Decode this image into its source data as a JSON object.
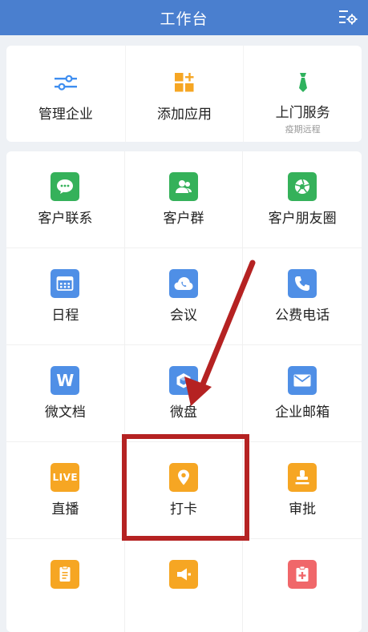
{
  "header": {
    "title": "工作台",
    "settings_icon": "list-settings-icon"
  },
  "top_tiles": [
    {
      "label": "管理企业",
      "icon": "sliders-icon"
    },
    {
      "label": "添加应用",
      "icon": "add-app-icon"
    },
    {
      "label": "上门服务",
      "sub": "疫期远程",
      "icon": "tie-icon"
    }
  ],
  "grid_tiles": [
    {
      "label": "客户联系",
      "icon": "chat-icon"
    },
    {
      "label": "客户群",
      "icon": "group-icon"
    },
    {
      "label": "客户朋友圈",
      "icon": "aperture-icon"
    },
    {
      "label": "日程",
      "icon": "calendar-icon"
    },
    {
      "label": "会议",
      "icon": "cloud-phone-icon"
    },
    {
      "label": "公费电话",
      "icon": "phone-icon"
    },
    {
      "label": "微文档",
      "icon": "w-doc-icon",
      "letter": "W"
    },
    {
      "label": "微盘",
      "icon": "cube-disk-icon"
    },
    {
      "label": "企业邮箱",
      "icon": "mail-icon"
    },
    {
      "label": "直播",
      "icon": "live-icon",
      "badge": "LIVE"
    },
    {
      "label": "打卡",
      "icon": "location-pin-icon"
    },
    {
      "label": "审批",
      "icon": "stamp-icon"
    },
    {
      "label": "",
      "icon": "report-icon"
    },
    {
      "label": "",
      "icon": "announcement-icon"
    },
    {
      "label": "",
      "icon": "medical-kit-icon"
    }
  ],
  "colors": {
    "header": "#4a7fcf",
    "green": "#35b15a",
    "blue": "#4f8fe6",
    "orange": "#f6a623",
    "pink": "#f0676a",
    "annotation": "#b52222"
  }
}
